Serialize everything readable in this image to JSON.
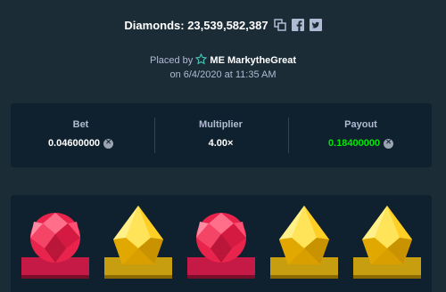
{
  "header": {
    "title": "Diamonds: 23,539,582,387",
    "icons": [
      "copy-icon",
      "facebook-icon",
      "twitter-icon"
    ]
  },
  "placed": {
    "prefix": "Placed by",
    "user": "ME MarkytheGreat",
    "date_line": "on 6/4/2020 at 11:35 AM"
  },
  "stats": {
    "bet": {
      "label": "Bet",
      "value": "0.04600000"
    },
    "multiplier": {
      "label": "Multiplier",
      "value": "4.00×"
    },
    "payout": {
      "label": "Payout",
      "value": "0.18400000"
    }
  },
  "colors": {
    "background": "#1b2c37",
    "panel": "#0f212e",
    "payout_green": "#00e701",
    "ruby": "#e8244c",
    "topaz": "#f5c000"
  },
  "gems": [
    "ruby",
    "topaz",
    "ruby",
    "topaz",
    "topaz"
  ]
}
